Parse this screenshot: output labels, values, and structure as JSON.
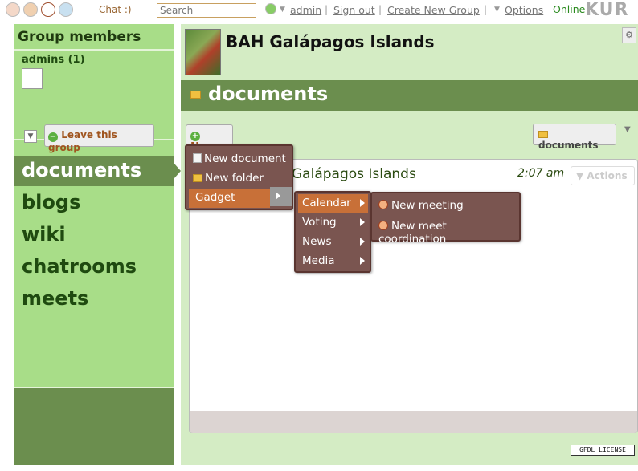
{
  "topbar": {
    "chat": "Chat :)",
    "search_placeholder": "Search",
    "admin": "admin",
    "signout": "Sign out",
    "create_group": "Create New Group",
    "options": "Options",
    "online": "Online",
    "logo": "KUR"
  },
  "sidebar": {
    "members_title": "Group members",
    "admins": "admins (1)",
    "leave": "Leave this group",
    "nav": [
      "documents",
      "blogs",
      "wiki",
      "chatrooms",
      "meets"
    ]
  },
  "main": {
    "group_title": "BAH Galápagos Islands",
    "section_title": "documents",
    "new_button": "New",
    "documents_button": "documents",
    "panel_title": "Galápagos Islands",
    "panel_time": "2:07 am",
    "actions": "Actions",
    "license": "GFDL LICENSE"
  },
  "menus": {
    "new_menu": [
      "New document",
      "New folder",
      "Gadget"
    ],
    "gadget_menu": [
      "Calendar",
      "Voting",
      "News",
      "Media"
    ],
    "calendar_menu": [
      "New meeting",
      "New meet coordination"
    ]
  },
  "colors": {
    "sidebar_green": "#a8dd88",
    "dark_green": "#6b8e4e",
    "main_green": "#d4ecc4",
    "menu_brown": "#7a5550",
    "menu_highlight": "#c87038"
  }
}
